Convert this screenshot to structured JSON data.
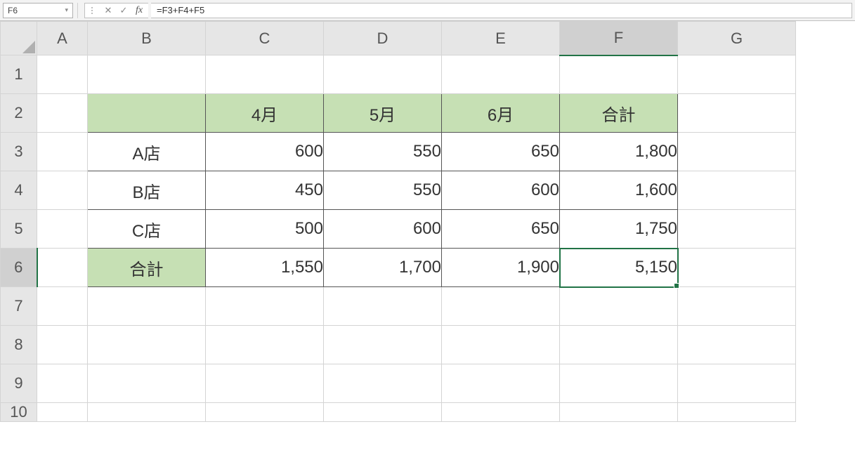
{
  "formula_bar": {
    "cell_reference": "F6",
    "cancel_label": "✕",
    "confirm_label": "✓",
    "fx_label": "fx",
    "formula": "=F3+F4+F5"
  },
  "columns": [
    "A",
    "B",
    "C",
    "D",
    "E",
    "F",
    "G"
  ],
  "rows": [
    "1",
    "2",
    "3",
    "4",
    "5",
    "6",
    "7",
    "8",
    "9",
    "10"
  ],
  "active_column": "F",
  "active_row": "6",
  "table": {
    "header": {
      "b2": "",
      "c2": "4月",
      "d2": "5月",
      "e2": "6月",
      "f2": "合計"
    },
    "rows": [
      {
        "label": "A店",
        "c": "600",
        "d": "550",
        "e": "650",
        "f": "1,800"
      },
      {
        "label": "B店",
        "c": "450",
        "d": "550",
        "e": "600",
        "f": "1,600"
      },
      {
        "label": "C店",
        "c": "500",
        "d": "600",
        "e": "650",
        "f": "1,750"
      }
    ],
    "totals": {
      "label": "合計",
      "c": "1,550",
      "d": "1,700",
      "e": "1,900",
      "f": "5,150"
    }
  }
}
